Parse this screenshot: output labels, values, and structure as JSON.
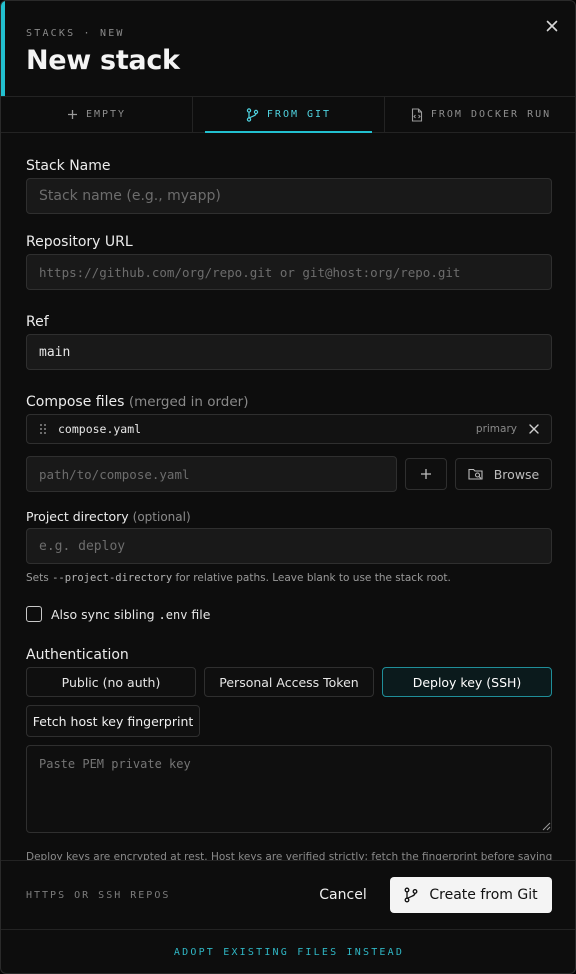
{
  "header": {
    "eyebrow": "STACKS · NEW",
    "title": "New stack",
    "accent_color": "#22c0cf"
  },
  "tabs": [
    {
      "label": "EMPTY",
      "icon": "plus-icon",
      "active": false
    },
    {
      "label": "FROM GIT",
      "icon": "git-branch-icon",
      "active": true
    },
    {
      "label": "FROM DOCKER RUN",
      "icon": "file-code-icon",
      "active": false
    }
  ],
  "form": {
    "stack_name": {
      "label": "Stack Name",
      "placeholder": "Stack name (e.g., myapp)",
      "value": ""
    },
    "repo_url": {
      "label": "Repository URL",
      "placeholder": "https://github.com/org/repo.git or git@host:org/repo.git",
      "value": ""
    },
    "ref": {
      "label": "Ref",
      "value": "main"
    },
    "compose": {
      "label": "Compose files",
      "label_note": "(merged in order)",
      "files": [
        {
          "name": "compose.yaml",
          "tag": "primary"
        }
      ],
      "add_placeholder": "path/to/compose.yaml",
      "browse_label": "Browse"
    },
    "project_dir": {
      "label": "Project directory",
      "label_note": "(optional)",
      "placeholder": "e.g. deploy",
      "hint_before": "Sets ",
      "hint_code": "--project-directory",
      "hint_after": " for relative paths. Leave blank to use the stack root."
    },
    "sync_env": {
      "label_before": "Also sync sibling ",
      "label_code": ".env",
      "label_after": " file",
      "checked": false
    },
    "auth": {
      "label": "Authentication",
      "options": [
        "Public (no auth)",
        "Personal Access Token",
        "Deploy key (SSH)"
      ],
      "selected": "Deploy key (SSH)",
      "fetch_label": "Fetch host key fingerprint",
      "key_placeholder": "Paste PEM private key",
      "note": "Deploy keys are encrypted at rest. Host keys are verified strictly; fetch the fingerprint before saving a"
    }
  },
  "footer": {
    "hint": "HTTPS OR SSH REPOS",
    "cancel_label": "Cancel",
    "create_label": "Create from Git"
  },
  "adopt_label": "ADOPT EXISTING FILES INSTEAD"
}
